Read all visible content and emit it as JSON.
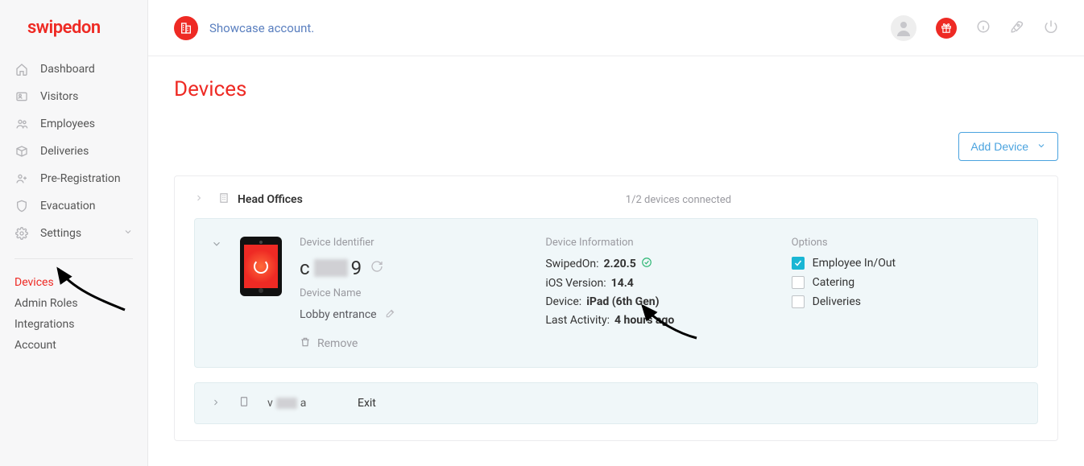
{
  "brand": "swipedon",
  "header": {
    "account_label": "Showcase account."
  },
  "nav": {
    "items": [
      {
        "label": "Dashboard",
        "icon": "home"
      },
      {
        "label": "Visitors",
        "icon": "id"
      },
      {
        "label": "Employees",
        "icon": "people"
      },
      {
        "label": "Deliveries",
        "icon": "box"
      },
      {
        "label": "Pre-Registration",
        "icon": "userplus"
      },
      {
        "label": "Evacuation",
        "icon": "shield"
      },
      {
        "label": "Settings",
        "icon": "gear",
        "chevron": true
      }
    ],
    "sub": [
      {
        "label": "Devices",
        "active": true
      },
      {
        "label": "Admin Roles"
      },
      {
        "label": "Integrations"
      },
      {
        "label": "Account"
      }
    ]
  },
  "page": {
    "title": "Devices",
    "add_button": "Add Device"
  },
  "group": {
    "title": "Head Offices",
    "status": "1/2 devices connected"
  },
  "device": {
    "labels": {
      "identifier": "Device Identifier",
      "name": "Device Name",
      "info": "Device Information",
      "options": "Options",
      "remove": "Remove"
    },
    "id_prefix": "c",
    "id_suffix": "9",
    "name": "Lobby entrance",
    "info": {
      "swipedon_k": "SwipedOn:",
      "swipedon_v": "2.20.5",
      "ios_k": "iOS Version:",
      "ios_v": "14.4",
      "device_k": "Device:",
      "device_v": "iPad (6th Gen)",
      "activity_k": "Last Activity:",
      "activity_v": "4 hours ago"
    },
    "options": {
      "opt1": "Employee In/Out",
      "opt2": "Catering",
      "opt3": "Deliveries"
    }
  },
  "device2": {
    "id_prefix": "v",
    "id_suffix": "a",
    "name": "Exit"
  }
}
